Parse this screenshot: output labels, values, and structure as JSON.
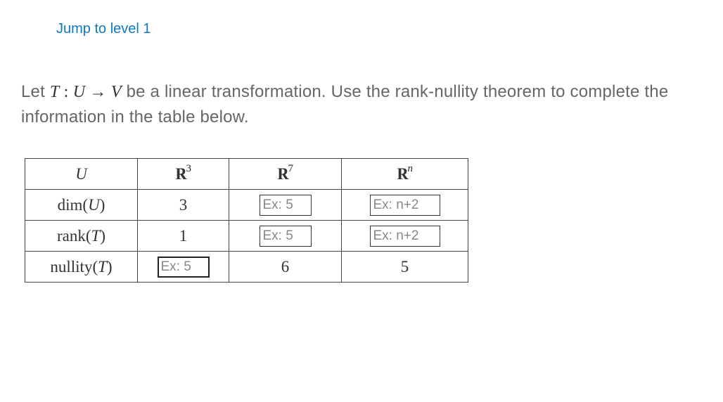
{
  "jump_link": "Jump to level 1",
  "problem_text": {
    "prefix": "Let ",
    "T": "T",
    "colon": " : ",
    "U": "U",
    "arrow": " → ",
    "V": "V",
    "suffix": " be a linear transformation. Use the rank-nullity theorem to complete the information in the table below."
  },
  "table": {
    "header": {
      "label": "U",
      "col1_sup": "3",
      "col2_sup": "7",
      "col3_sup": "n"
    },
    "rows": [
      {
        "label": "dim",
        "arg": "U",
        "c1": "3",
        "c2_placeholder": "Ex: 5",
        "c3_placeholder": "Ex: n+2"
      },
      {
        "label": "rank",
        "arg": "T",
        "c1": "1",
        "c2_placeholder": "Ex: 5",
        "c3_placeholder": "Ex: n+2"
      },
      {
        "label": "nullity",
        "arg": "T",
        "c1_placeholder": "Ex: 5",
        "c2": "6",
        "c3": "5"
      }
    ]
  }
}
